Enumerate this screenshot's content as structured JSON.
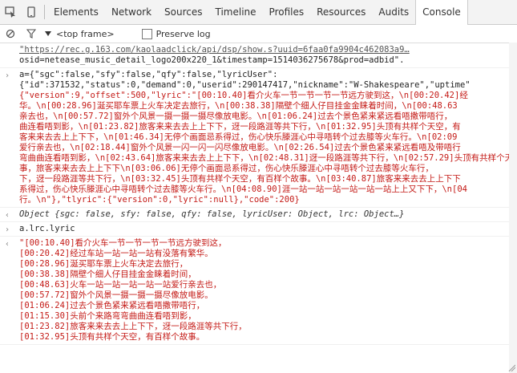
{
  "toolbar": {
    "tabs": [
      "Elements",
      "Network",
      "Sources",
      "Timeline",
      "Profiles",
      "Resources",
      "Audits",
      "Console"
    ]
  },
  "filterbar": {
    "context": "<top frame>",
    "preserve_log": "Preserve log"
  },
  "console": {
    "url_line1": "\"https://rec.g.163.com/kaolaadclick/api/dsp/show.s?uuid=6faa0fa9904c462083a9…",
    "url_line2": "osid=netease_music_detail_logo200x220_1&timestamp=1514036275678&prod=adbid\".",
    "out_lines": [
      "a={\"sgc\":false,\"sfy\":false,\"qfy\":false,\"lyricUser\":",
      "{\"id\":371532,\"status\":0,\"demand\":0,\"userid\":290147417,\"nickname\":\"W-Shakespeare\",\"uptime\"",
      "{\"version\":9,\"offset\":500,\"lyric\":\"[00:10.40]看介火车一节一节一节一节远方驶到这，\\n[00:20.42]经",
      "华。\\n[00:28.96]涎买耶车票上火车决定去旅行，\\n[00:38.38]隔壁个细人仔目挂金金睐着时间，\\n[00:48.63",
      "亲去也，\\n[00:57.72]窗外个风景一摄一摄一摄尽像放电影。\\n[01:06.24]过去个景色紧来紧远看唔撒带唔行，",
      "曲连看唔到影，\\n[01:23.82]旅客来来去去上上下下，迓一段路涯等共下行，\\n[01:32.95]头顶有共样个天空，有",
      "客来来去去上上下下，\\n[01:46.34]无停个画面忌系得过，伤心快乐滕涯心中寻唔转个过去膝等火车行。\\n[02:09",
      "爱行亲去也，\\n[02:18.44]窗外个风景一闪一闪一闪尽像放电影。\\n[02:26.54]过去个景色紧来紧远看唔及带唔行",
      "弯曲曲连看唔到影，\\n[02:43.64]旅客来来去去上上下下，\\n[02:48.31]迓一段路涯等共下行，\\n[02:57.29]头顶有共样个天空",
      "事，旅客来来去去上上下下\\n[03:06.06]无停个画面忌系得过，伤心快乐滕涯心中寻唔转个过去膝等火车行，",
      "下，迓一段路涯等共下行，\\n[03:32.45]头顶有共样个天空，有百样个故事。\\n[03:40.87]旅客来来去去上上下下",
      "系得过，伤心快乐滕涯心中寻唔转个过去膝等火车行。\\n[04:08.90]涯一站一站一站一站一站一站上上又下下，\\n[04",
      "行。\\n\"},\"tlyric\":{\"version\":0,\"lyric\":null},\"code\":200}"
    ],
    "object_summary": "Object {sgc: false, sfy: false, qfy: false, lyricUser: Object, lrc: Object…}",
    "command": "a.lrc.lyric",
    "lyric_lines": [
      "\"[00:10.40]看介火车一节一节一节一节远方驶到这，",
      "[00:20.42]经过车站一站一站一站有没落有繁华。",
      "[00:28.96]涎买耶车票上火车决定去旅行，",
      "[00:38.38]隔壁个细人仔目挂金金睐着时间，",
      "[00:48.63]火车一站一站一站一站一站爱行亲去也，",
      "[00:57.72]窗外个风景一摄一摄一摄尽像放电影。",
      "[01:06.24]过去个景色紧来紧远看唔撒带唔行，",
      "[01:15.30]头前个来路弯弯曲曲连看唔到影，",
      "[01:23.82]旅客来来去去上上下下，迓一段路涯等共下行，",
      "[01:32.95]头顶有共样个天空，有百样个故事。"
    ]
  }
}
